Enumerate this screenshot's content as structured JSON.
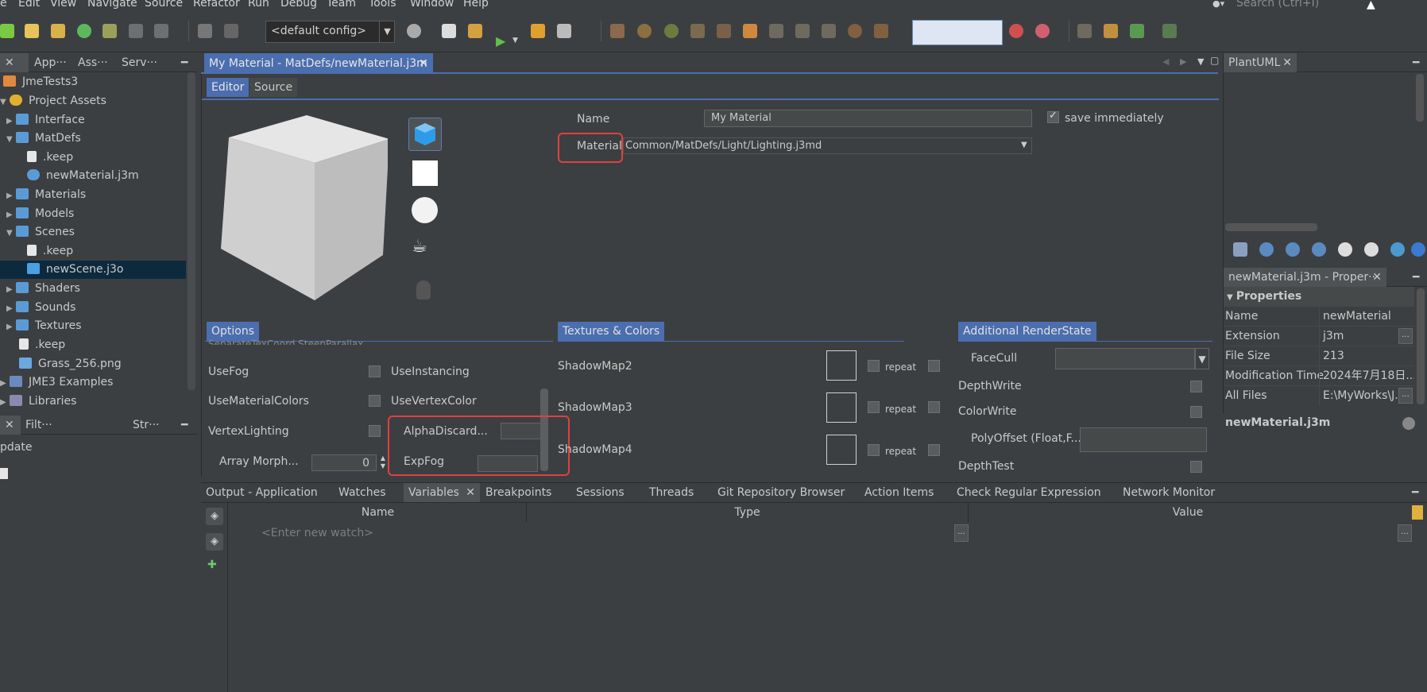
{
  "menu": [
    "e",
    "Edit",
    "View",
    "Navigate",
    "Source",
    "Refactor",
    "Run",
    "Debug",
    "Team",
    "Tools",
    "Window",
    "Help"
  ],
  "search": {
    "placeholder": "Search (Ctrl+I)"
  },
  "toolbar": {
    "config": "<default config>"
  },
  "left_tabs": [
    "App···",
    "Ass···",
    "Serv···"
  ],
  "tree": [
    {
      "label": "JmeTests3"
    },
    {
      "label": "Project Assets"
    },
    {
      "label": "Interface"
    },
    {
      "label": "MatDefs"
    },
    {
      "label": ".keep"
    },
    {
      "label": "newMaterial.j3m"
    },
    {
      "label": "Materials"
    },
    {
      "label": "Models"
    },
    {
      "label": "Scenes"
    },
    {
      "label": ".keep"
    },
    {
      "label": "newScene.j3o"
    },
    {
      "label": "Shaders"
    },
    {
      "label": "Sounds"
    },
    {
      "label": "Textures"
    },
    {
      "label": ".keep"
    },
    {
      "label": "Grass_256.png"
    },
    {
      "label": "JME3 Examples"
    },
    {
      "label": "Libraries"
    }
  ],
  "lower_left_tabs": [
    "Filt···",
    "Str···"
  ],
  "lower_left_text": "pdate",
  "editor": {
    "doc_tab": "My Material - MatDefs/newMaterial.j3m",
    "subtabs": [
      "Editor",
      "Source"
    ],
    "name_label": "Name",
    "name_value": "My Material",
    "save_label": "save immediately",
    "material_label": "Material",
    "material_value": "Common/MatDefs/Light/Lighting.j3md",
    "options_tab": "Options",
    "options_cut": "SeparateTexCoord   SteepParallax",
    "options": [
      {
        "l": "UseFog",
        "r": "UseInstancing"
      },
      {
        "l": "UseMaterialColors",
        "r": "UseVertexColor"
      },
      {
        "l": "VertexLighting",
        "r": "AlphaDiscard..."
      },
      {
        "l": "Array Morph...",
        "r": "ExpFog"
      }
    ],
    "morph_value": "0",
    "textures_tab": "Textures & Colors",
    "textures": [
      "ShadowMap2",
      "ShadowMap3",
      "ShadowMap4"
    ],
    "repeat_label": "repeat",
    "renderstate_tab": "Additional RenderState",
    "renderstate": [
      "FaceCull",
      "DepthWrite",
      "ColorWrite",
      "PolyOffset (Float,F...",
      "DepthTest"
    ]
  },
  "plantuml_tab": "PlantUML",
  "properties": {
    "tab": "newMaterial.j3m - Proper···",
    "header": "Properties",
    "rows": [
      {
        "k": "Name",
        "v": "newMaterial"
      },
      {
        "k": "Extension",
        "v": "j3m"
      },
      {
        "k": "File Size",
        "v": "213"
      },
      {
        "k": "Modification Time",
        "v": "2024年7月18日..."
      },
      {
        "k": "All Files",
        "v": "E:\\MyWorks\\J..."
      }
    ],
    "footer": "newMaterial.j3m"
  },
  "bottom_tabs": [
    "Output - Application",
    "Watches",
    "Variables",
    "Breakpoints",
    "Sessions",
    "Threads",
    "Git Repository Browser",
    "Action Items",
    "Check Regular Expression",
    "Network Monitor"
  ],
  "watch_table": {
    "columns": [
      "Name",
      "Type",
      "Value"
    ],
    "placeholder": "<Enter new watch>"
  }
}
